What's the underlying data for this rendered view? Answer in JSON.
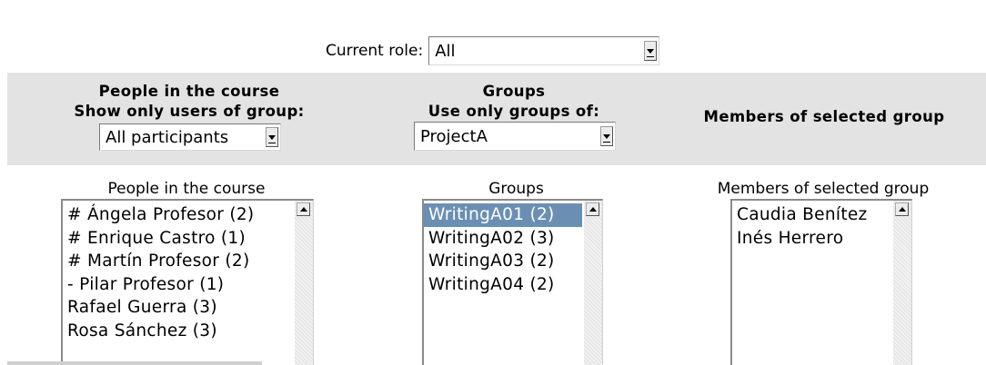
{
  "role": {
    "label": "Current role:",
    "value": "All"
  },
  "columns": {
    "people": {
      "header_line1": "People in the course",
      "header_line2": "Show only users of group:",
      "filter_value": "All participants",
      "list_label": "People in the course",
      "items": [
        "# Ángela Profesor (2)",
        "# Enrique Castro (1)",
        "# Martín Profesor (2)",
        "- Pilar Profesor (1)",
        "Rafael Guerra (3)",
        "Rosa Sánchez (3)"
      ]
    },
    "groups": {
      "header_line1": "Groups",
      "header_line2": "Use only groups of:",
      "grouping_value": "ProjectA",
      "list_label": "Groups",
      "selected": "WritingA01 (2)",
      "items": [
        "WritingA01 (2)",
        "WritingA02 (3)",
        "WritingA03 (2)",
        "WritingA04 (2)"
      ]
    },
    "members": {
      "header": "Members of selected group",
      "list_label": "Members of selected group",
      "items": [
        "Caudia Benítez",
        "Inés Herrero"
      ]
    }
  }
}
